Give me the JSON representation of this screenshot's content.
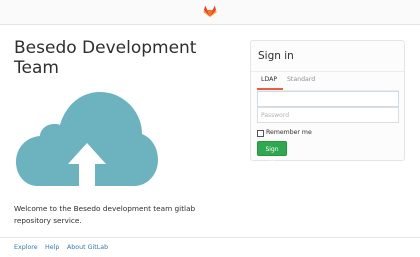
{
  "brand": {
    "title": "Besedo Development Team",
    "welcome": "Welcome to the Besedo development team gitlab repository service."
  },
  "login": {
    "title": "Sign in",
    "tabs": [
      {
        "label": "LDAP",
        "active": true
      },
      {
        "label": "Standard",
        "active": false
      }
    ],
    "username_placeholder": "",
    "password_placeholder": "Password",
    "remember_label": "Remember me",
    "submit_label": "Sign in"
  },
  "footer": {
    "links": [
      "Explore",
      "Help",
      "About GitLab"
    ]
  },
  "colors": {
    "accent_tab": "#e75e40",
    "submit": "#2fa84f",
    "link": "#3777b0",
    "cloud": "#6db2bf"
  },
  "icons": {
    "logo": "gitlab-tanuki-icon",
    "hero": "cloud-upload-icon"
  }
}
